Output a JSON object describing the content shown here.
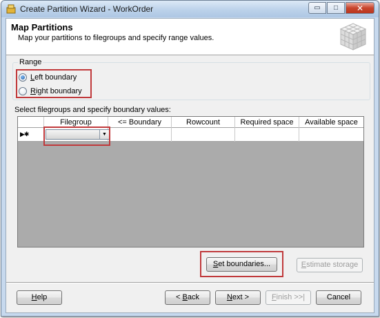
{
  "window": {
    "title": "Create Partition Wizard - WorkOrder",
    "minimize_glyph": "▭",
    "maximize_glyph": "□",
    "close_glyph": "✕"
  },
  "header": {
    "title": "Map Partitions",
    "subtitle": "Map your partitions to filegroups and specify range values."
  },
  "range": {
    "legend": "Range",
    "options": [
      {
        "accel": "L",
        "rest": "eft boundary",
        "checked": true
      },
      {
        "accel": "R",
        "rest": "ight boundary",
        "checked": false
      }
    ]
  },
  "grid": {
    "label": "Select filegroups and specify boundary values:",
    "columns": [
      "Filegroup",
      "<= Boundary",
      "Rowcount",
      "Required space",
      "Available space"
    ],
    "new_row_marker": "▶✱",
    "combo_arrow": "▼"
  },
  "buttons": {
    "set_boundaries": {
      "accel": "S",
      "rest": "et boundaries..."
    },
    "estimate_storage": {
      "accel": "E",
      "rest": "stimate storage"
    },
    "help": {
      "accel": "H",
      "rest": "elp"
    },
    "back": {
      "prefix": "< ",
      "accel": "B",
      "rest": "ack"
    },
    "next": {
      "accel": "N",
      "rest": "ext >"
    },
    "finish": {
      "accel": "F",
      "rest": "inish >>|"
    },
    "cancel": {
      "label": "Cancel"
    }
  },
  "colors": {
    "highlight": "#c0393b",
    "titlebar": "#bcd2ea",
    "grid_background": "#ababab"
  }
}
